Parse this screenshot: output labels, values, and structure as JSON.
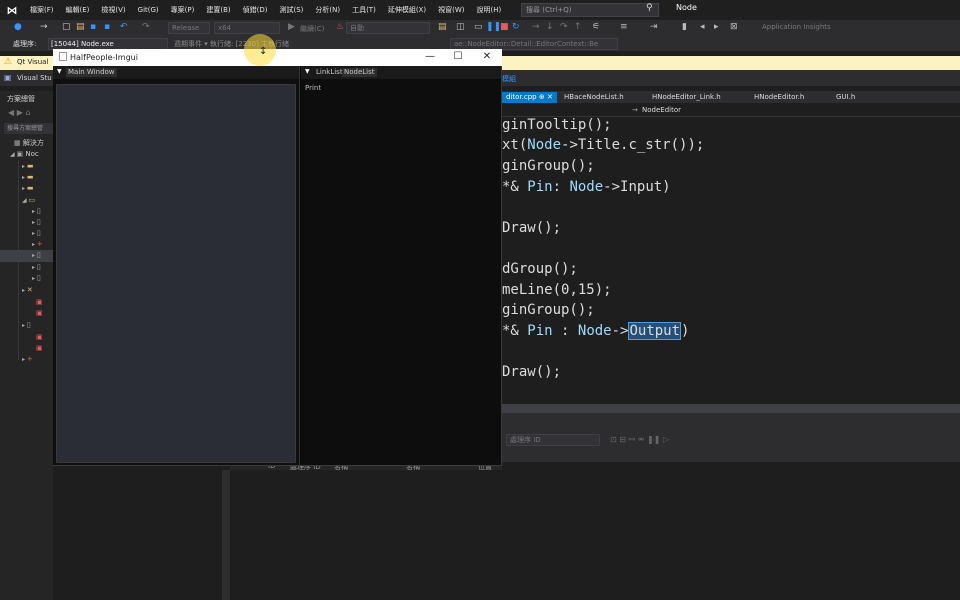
{
  "menubar": {
    "items": [
      "檔案(F)",
      "編輯(E)",
      "檢視(V)",
      "Git(G)",
      "專案(P)",
      "建置(B)",
      "偵錯(D)",
      "測試(S)",
      "分析(N)",
      "工具(T)",
      "延伸模組(X)",
      "視窗(W)",
      "說明(H)"
    ],
    "search_placeholder": "搜尋 (Ctrl+Q)",
    "solution_name": "Node"
  },
  "toolbar": {
    "config": "Release",
    "platform": "x64",
    "continue_label": "繼續(C)",
    "stack_label": "自動",
    "app_insights": "Application Insights"
  },
  "process_bar": {
    "label": "處理序:",
    "value": "[15044] Node.exe",
    "lifecycle": "週期事件 ▾  執行緒: [2230] 主執行緒",
    "stack_frame": "ae::NodeEditor::Detail::EditorContext::Be"
  },
  "infobar": {
    "text": "Qt Visual"
  },
  "bar2": {
    "left_text": "Visual Stu",
    "right_text": "模組"
  },
  "solution_explorer": {
    "title": "方案總管",
    "search": "搜尋方案總管",
    "solution_label": "解決方",
    "project_label": "Noc"
  },
  "imgui": {
    "window_title": "HalfPeople-Imgui",
    "main_window_tab": "Main Window",
    "right_tabs": [
      "LinkList",
      "NodeList"
    ],
    "print_label": "Print"
  },
  "editor": {
    "tabs": [
      "ditor.cpp",
      "HBaceNodeList.h",
      "HNodeEditor_Link.h",
      "HNodeEditor.h",
      "GUI.h"
    ],
    "nav_function": "NodeEditor"
  },
  "output": {
    "combo": "處理序 ID",
    "grid_headers": [
      "ID",
      "處理序 ID",
      "名稱",
      "名稱",
      "位置"
    ]
  }
}
